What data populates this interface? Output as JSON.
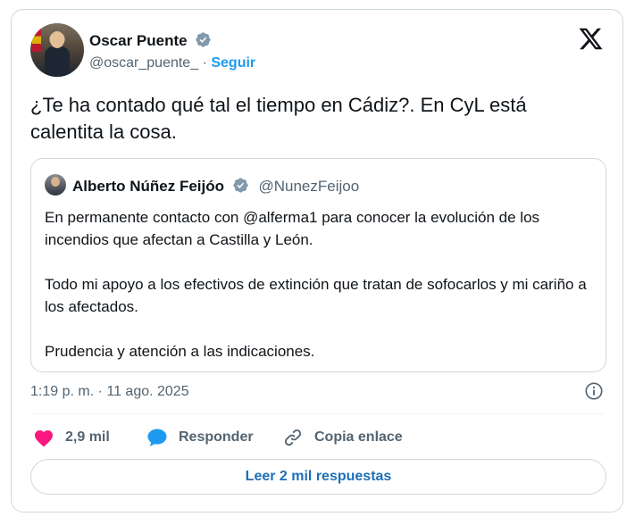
{
  "author": {
    "name": "Oscar Puente",
    "handle": "@oscar_puente_",
    "separator": "·",
    "follow_label": "Seguir",
    "verified_icon": "verified-badge-icon"
  },
  "tweet": {
    "text": "¿Te ha contado qué tal el tiempo en Cádiz?. En CyL está calentita la cosa."
  },
  "quoted": {
    "name": "Alberto Núñez Feijóo",
    "handle": "@NunezFeijoo",
    "paragraphs": [
      "En permanente contacto con @alferma1 para conocer la evolución de los incendios que afectan a Castilla y León.",
      "Todo mi apoyo a los efectivos de extinción que tratan de sofocarlos y mi cariño a los afectados.",
      "Prudencia y atención a las indicaciones."
    ]
  },
  "meta": {
    "timestamp": "1:19 p. m. · 11 ago. 2025"
  },
  "actions": {
    "likes": "2,9 mil",
    "reply_label": "Responder",
    "copy_label": "Copia enlace"
  },
  "footer": {
    "read_replies_label": "Leer 2 mil respuestas"
  },
  "colors": {
    "accent": "#1d9bf0",
    "like": "#f91880",
    "muted": "#536471",
    "border": "#cfd9de"
  }
}
